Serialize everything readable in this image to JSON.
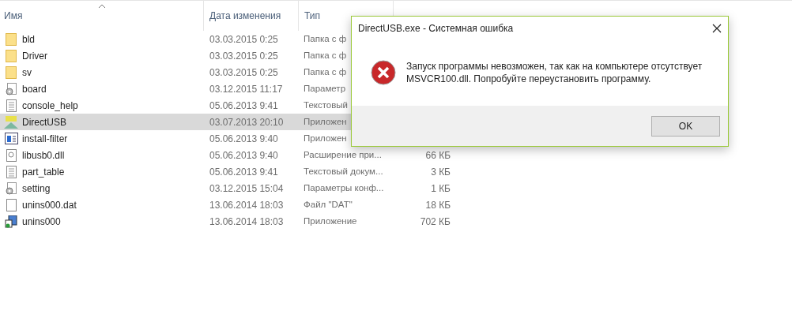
{
  "file_list": {
    "columns": [
      {
        "label": "Имя",
        "sorted": true
      },
      {
        "label": "Дата изменения",
        "sorted": false
      },
      {
        "label": "Тип",
        "sorted": false
      }
    ],
    "rows": [
      {
        "kind": "folder",
        "name": "bld",
        "date": "03.03.2015 0:25",
        "type": "Папка с ф",
        "selected": false
      },
      {
        "kind": "folder",
        "name": "Driver",
        "date": "03.03.2015 0:25",
        "type": "Папка с ф",
        "selected": false
      },
      {
        "kind": "folder",
        "name": "sv",
        "date": "03.03.2015 0:25",
        "type": "Папка с ф",
        "selected": false
      },
      {
        "kind": "config",
        "name": "board",
        "date": "03.12.2015 11:17",
        "type": "Параметр",
        "selected": false
      },
      {
        "kind": "text",
        "name": "console_help",
        "date": "05.06.2013 9:41",
        "type": "Текстовый",
        "selected": false
      },
      {
        "kind": "app",
        "name": "DirectUSB",
        "date": "03.07.2013 20:10",
        "type": "Приложен",
        "selected": true
      },
      {
        "kind": "window",
        "name": "install-filter",
        "date": "05.06.2013 9:40",
        "type": "Приложен",
        "selected": false
      },
      {
        "kind": "dll",
        "name": "libusb0.dll",
        "date": "05.06.2013 9:40",
        "type": "Расширение при...",
        "size": "66 КБ",
        "selected": false
      },
      {
        "kind": "text",
        "name": "part_table",
        "date": "05.06.2013 9:41",
        "type": "Текстовый докум...",
        "size": "3 КБ",
        "selected": false
      },
      {
        "kind": "config",
        "name": "setting",
        "date": "03.12.2015 15:04",
        "type": "Параметры конф...",
        "size": "1 КБ",
        "selected": false
      },
      {
        "kind": "blank",
        "name": "unins000.dat",
        "date": "13.06.2014 18:03",
        "type": "Файл \"DAT\"",
        "size": "18 КБ",
        "selected": false
      },
      {
        "kind": "installer",
        "name": "unins000",
        "date": "13.06.2014 18:03",
        "type": "Приложение",
        "size": "702 КБ",
        "selected": false
      }
    ]
  },
  "dialog": {
    "title": "DirectUSB.exe - Системная ошибка",
    "message": "Запуск программы невозможен, так как на компьютере отсутствует MSVCR100.dll. Попробуйте переустановить программу.",
    "button": "OK"
  }
}
